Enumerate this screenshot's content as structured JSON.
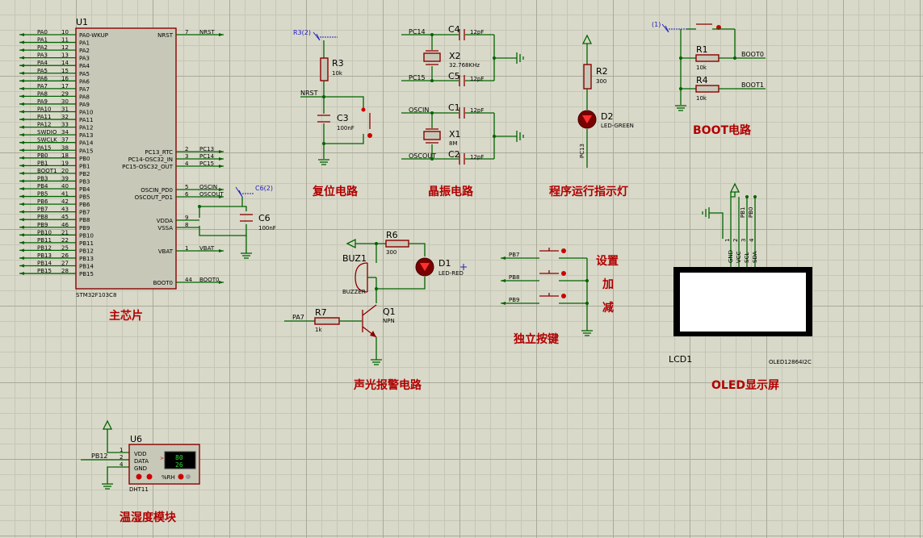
{
  "sections": {
    "main_chip": "主芯片",
    "reset": "复位电路",
    "crystal": "晶振电路",
    "run_led": "程序运行指示灯",
    "boot": "BOOT电路",
    "alarm": "声光报警电路",
    "keys": "独立按键",
    "oled": "OLED显示屏",
    "temp_hum": "温湿度模块"
  },
  "mcu": {
    "ref": "U1",
    "part": "STM32F103C8",
    "left_pins": [
      {
        "net": "PA0",
        "num": "10",
        "name": "PA0-WKUP"
      },
      {
        "net": "PA1",
        "num": "11",
        "name": "PA1"
      },
      {
        "net": "PA2",
        "num": "12",
        "name": "PA2"
      },
      {
        "net": "PA3",
        "num": "13",
        "name": "PA3"
      },
      {
        "net": "PA4",
        "num": "14",
        "name": "PA4"
      },
      {
        "net": "PA5",
        "num": "15",
        "name": "PA5"
      },
      {
        "net": "PA6",
        "num": "16",
        "name": "PA6"
      },
      {
        "net": "PA7",
        "num": "17",
        "name": "PA7"
      },
      {
        "net": "PA8",
        "num": "29",
        "name": "PA8"
      },
      {
        "net": "PA9",
        "num": "30",
        "name": "PA9"
      },
      {
        "net": "PA10",
        "num": "31",
        "name": "PA10"
      },
      {
        "net": "PA11",
        "num": "32",
        "name": "PA11"
      },
      {
        "net": "PA12",
        "num": "33",
        "name": "PA12"
      },
      {
        "net": "SWDIO",
        "num": "34",
        "name": "PA13"
      },
      {
        "net": "SWCLK",
        "num": "37",
        "name": "PA14"
      },
      {
        "net": "PA15",
        "num": "38",
        "name": "PA15"
      },
      {
        "net": "PB0",
        "num": "18",
        "name": "PB0"
      },
      {
        "net": "PB1",
        "num": "19",
        "name": "PB1"
      },
      {
        "net": "BOOT1",
        "num": "20",
        "name": "PB2"
      },
      {
        "net": "PB3",
        "num": "39",
        "name": "PB3"
      },
      {
        "net": "PB4",
        "num": "40",
        "name": "PB4"
      },
      {
        "net": "PB5",
        "num": "41",
        "name": "PB5"
      },
      {
        "net": "PB6",
        "num": "42",
        "name": "PB6"
      },
      {
        "net": "PB7",
        "num": "43",
        "name": "PB7"
      },
      {
        "net": "PB8",
        "num": "45",
        "name": "PB8"
      },
      {
        "net": "PB9",
        "num": "46",
        "name": "PB9"
      },
      {
        "net": "PB10",
        "num": "21",
        "name": "PB10"
      },
      {
        "net": "PB11",
        "num": "22",
        "name": "PB11"
      },
      {
        "net": "PB12",
        "num": "25",
        "name": "PB12"
      },
      {
        "net": "PB13",
        "num": "26",
        "name": "PB13"
      },
      {
        "net": "PB14",
        "num": "27",
        "name": "PB14"
      },
      {
        "net": "PB15",
        "num": "28",
        "name": "PB15"
      }
    ],
    "right_pins": [
      {
        "name": "NRST",
        "num": "7",
        "net": "NRST"
      },
      {
        "name": "PC13_RTC",
        "num": "2",
        "net": "PC13"
      },
      {
        "name": "PC14-OSC32_IN",
        "num": "3",
        "net": "PC14"
      },
      {
        "name": "PC15-OSC32_OUT",
        "num": "4",
        "net": "PC15"
      },
      {
        "name": "OSCIN_PD0",
        "num": "5",
        "net": "OSCIN"
      },
      {
        "name": "OSCOUT_PD1",
        "num": "6",
        "net": "OSCOUT"
      },
      {
        "name": "VDDA",
        "num": "9",
        "net": ""
      },
      {
        "name": "VSSA",
        "num": "8",
        "net": ""
      },
      {
        "name": "VBAT",
        "num": "1",
        "net": "VBAT"
      },
      {
        "name": "BOOT0",
        "num": "44",
        "net": "BOOT0"
      }
    ]
  },
  "c6": {
    "ref": "C6",
    "value": "100nF",
    "probe": "C6(2)"
  },
  "reset": {
    "probe": "R3(2)",
    "r_ref": "R3",
    "r_val": "10k",
    "net": "NRST",
    "c_ref": "C3",
    "c_val": "100nF"
  },
  "crystal": {
    "pc14": "PC14",
    "pc15": "PC15",
    "oscin": "OSCIN",
    "oscout": "OSCOUT",
    "c4": "C4",
    "c5": "C5",
    "c1": "C1",
    "c2": "C2",
    "cap_val": "12pF",
    "x2": "X2",
    "x2_val": "32.768KHz",
    "x1": "X1",
    "x1_val": "8M"
  },
  "run_led": {
    "r_ref": "R2",
    "r_val": "300",
    "d_ref": "D2",
    "d_val": "LED-GREEN",
    "net": "PC13"
  },
  "boot": {
    "probe": "(1)",
    "r1": "R1",
    "r1_val": "10k",
    "r4": "R4",
    "r4_val": "10k",
    "boot0": "BOOT0",
    "boot1": "BOOT1"
  },
  "alarm": {
    "buz_ref": "BUZ1",
    "buz_val": "BUZZER",
    "r6": "R6",
    "r6_val": "300",
    "d1": "D1",
    "d1_val": "LED-RED",
    "r7": "R7",
    "r7_val": "1k",
    "q1": "Q1",
    "q1_val": "NPN",
    "net": "PA7"
  },
  "keys": {
    "nets": [
      "PB7",
      "PB8",
      "PB9"
    ],
    "labels": [
      "设置",
      "加",
      "减"
    ]
  },
  "oled": {
    "ref": "LCD1",
    "part": "OLED12864I2C",
    "pins": [
      {
        "name": "GND",
        "num": "1"
      },
      {
        "name": "VCC",
        "num": "2"
      },
      {
        "name": "SCL",
        "num": "3"
      },
      {
        "name": "SDA",
        "num": "4"
      }
    ],
    "nets": [
      "PB1",
      "PB0"
    ]
  },
  "dht": {
    "ref": "U6",
    "part": "DHT11",
    "net": "PB12",
    "pins": [
      {
        "name": "VDD",
        "num": "1"
      },
      {
        "name": "DATA",
        "num": "2"
      },
      {
        "name": "GND",
        "num": "4"
      }
    ],
    "temp": "80",
    "hum": "26",
    "rh": "%RH"
  }
}
